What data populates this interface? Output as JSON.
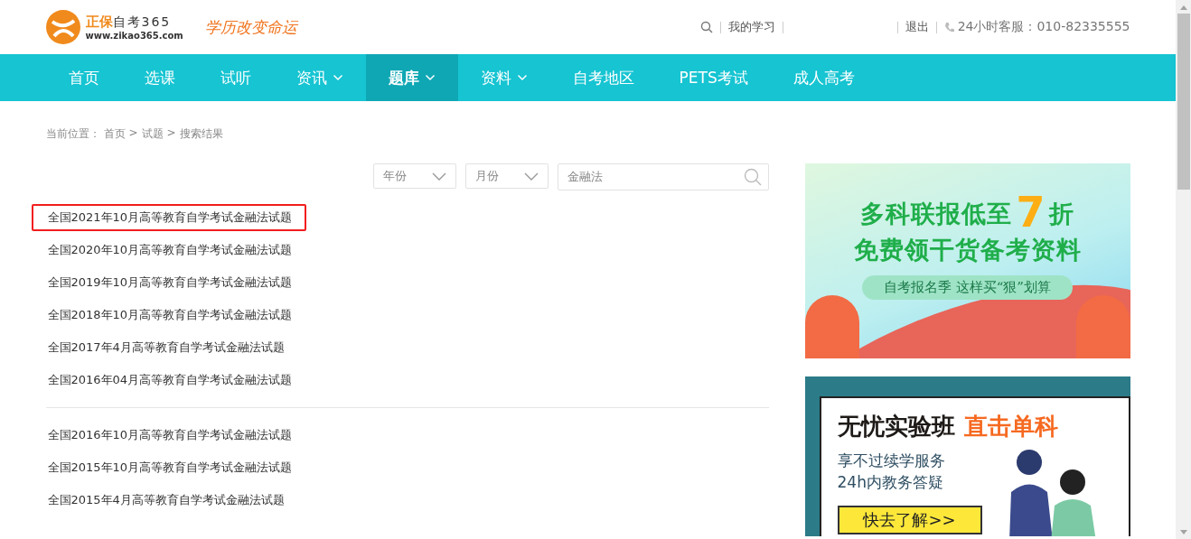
{
  "header": {
    "logo": {
      "brand": "正保",
      "name": "自考365",
      "url": "www.zikao365.com",
      "slogan": "学历改变命运"
    },
    "links": [
      {
        "kind": "search"
      },
      {
        "kind": "link",
        "label": "我的学习"
      },
      {
        "kind": "blank"
      },
      {
        "kind": "link",
        "label": "退出"
      },
      {
        "kind": "phone",
        "label": "24小时客服：010-82335555"
      }
    ]
  },
  "nav": [
    {
      "label": "首页",
      "selected": false,
      "dropdown": false
    },
    {
      "label": "选课",
      "selected": false,
      "dropdown": false
    },
    {
      "label": "试听",
      "selected": false,
      "dropdown": false
    },
    {
      "label": "资讯",
      "selected": false,
      "dropdown": true
    },
    {
      "label": "题库",
      "selected": true,
      "dropdown": true
    },
    {
      "label": "资料",
      "selected": false,
      "dropdown": true
    },
    {
      "label": "自考地区",
      "selected": false,
      "dropdown": false
    },
    {
      "label": "PETS考试",
      "selected": false,
      "dropdown": false
    },
    {
      "label": "成人高考",
      "selected": false,
      "dropdown": false
    }
  ],
  "breadcrumb": {
    "prefix": "当前位置：",
    "items": [
      "首页",
      "试题",
      "搜索结果"
    ],
    "separator": ">"
  },
  "filters": {
    "year": {
      "placeholder": "年份"
    },
    "month": {
      "placeholder": "月份"
    },
    "search": {
      "value": "金融法"
    }
  },
  "results": [
    [
      {
        "title": "全国2021年10月高等教育自学考试金融法试题",
        "highlighted": true
      },
      {
        "title": "全国2020年10月高等教育自学考试金融法试题",
        "highlighted": false
      },
      {
        "title": "全国2019年10月高等教育自学考试金融法试题",
        "highlighted": false
      },
      {
        "title": "全国2018年10月高等教育自学考试金融法试题",
        "highlighted": false
      },
      {
        "title": "全国2017年4月高等教育自学考试金融法试题",
        "highlighted": false
      },
      {
        "title": "全国2016年04月高等教育自学考试金融法试题",
        "highlighted": false
      }
    ],
    [
      {
        "title": "全国2016年10月高等教育自学考试金融法试题",
        "highlighted": false
      },
      {
        "title": "全国2015年10月高等教育自学考试金融法试题",
        "highlighted": false
      },
      {
        "title": "全国2015年4月高等教育自学考试金融法试题",
        "highlighted": false
      }
    ]
  ],
  "ads": [
    {
      "kind": "promo",
      "headline_1": "多科联报低至",
      "big": "7",
      "headline_1_end": "折",
      "headline_2": "免费领干货备考资料",
      "tagline": "自考报名季 这样买“狠”划算"
    },
    {
      "kind": "class",
      "headline": "无忧实验班",
      "highlight": "直击单科",
      "lines": [
        "享不过续学服务",
        "24h内教务答疑"
      ],
      "button": "快去了解>>"
    }
  ]
}
